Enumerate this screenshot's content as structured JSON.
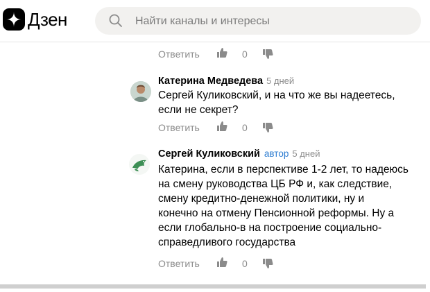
{
  "header": {
    "logo_text": "Дзен",
    "search_placeholder": "Найти каналы и интересы"
  },
  "top_actions": {
    "reply": "Ответить",
    "likes": "0"
  },
  "comments": [
    {
      "author": "Катерина Медведева",
      "time": "5 дней",
      "text": "Сергей Куликовский, и на что же вы надеетесь,\nесли не секрет?",
      "reply": "Ответить",
      "likes": "0"
    },
    {
      "author": "Сергей Куликовский",
      "author_badge": "автор",
      "time": "5 дней",
      "text": "Катерина, если в перспективе 1-2 лет, то надеюсь\nна смену руководства ЦБ РФ и, как следствие,\nсмену кредитно-денежной политики, ну и\nконечно на отмену Пенсионной реформы. Ну а\nесли глобально-в на построение социально-\nсправедливого государства",
      "reply": "Ответить",
      "likes": "0"
    }
  ],
  "colors": {
    "accent": "#2e7dd1",
    "muted": "#8b8b8b",
    "search_bg": "#f2f1ef"
  },
  "icons": [
    "zen-logo-icon",
    "search-icon",
    "thumb-up-icon",
    "thumb-down-icon"
  ]
}
